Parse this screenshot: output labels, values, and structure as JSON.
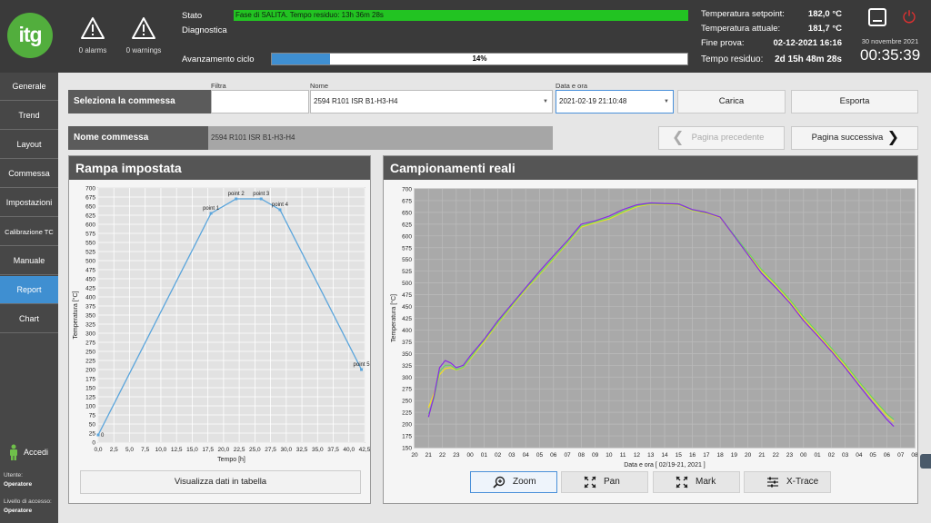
{
  "header": {
    "logo_text": "itg",
    "alarms": "0 alarms",
    "warnings": "0 warnings",
    "stato_label": "Stato",
    "stato_value": "Fase di SALITA. Tempo residuo: 13h 36m 28s",
    "diagnostica_label": "Diagnostica",
    "avanzamento_label": "Avanzamento ciclo",
    "progress_text": "14%",
    "progress_value": 14,
    "info": [
      {
        "label": "Temperatura setpoint:",
        "value": "182,0 °C"
      },
      {
        "label": "Temperatura attuale:",
        "value": "181,7 °C"
      },
      {
        "label": "Fine prova:",
        "value": "02-12-2021 16:16"
      },
      {
        "label": "Tempo residuo:",
        "value": "2d 15h 48m 28s"
      }
    ],
    "date": "30 novembre 2021",
    "time": "00:35:39"
  },
  "sidebar": {
    "items": [
      "Generale",
      "Trend",
      "Layout",
      "Commessa",
      "Impostazioni",
      "Calibrazione TC",
      "Manuale",
      "Report",
      "Chart"
    ],
    "active": "Report",
    "accedi": "Accedi",
    "utente_label": "Utente:",
    "utente_value": "Operatore",
    "livello_label": "Livello di accesso:",
    "livello_value": "Operatore"
  },
  "selection": {
    "title": "Seleziona la commessa",
    "filtra_label": "Filtra",
    "filtra_value": "",
    "nome_label": "Nome",
    "nome_value": "2594 R101 ISR B1-H3-H4",
    "data_label": "Data e ora",
    "data_value": "2021-02-19 21:10:48",
    "carica": "Carica",
    "esporta": "Esporta"
  },
  "nome_commessa": {
    "label": "Nome commessa",
    "value": "2594 R101 ISR B1-H3-H4",
    "prev": "Pagina precedente",
    "next": "Pagina successiva"
  },
  "left_panel": {
    "title": "Rampa impostata",
    "table_button": "Visualizza dati in tabella"
  },
  "right_panel": {
    "title": "Campionamenti reali",
    "tools": [
      "Zoom",
      "Pan",
      "Mark",
      "X-Trace"
    ],
    "selected_tool": "Zoom"
  },
  "colors": {
    "header_bg": "#3a3a3a",
    "sidebar_bg": "#474747",
    "accent": "#3f8fd1",
    "stato_green": "#22c322",
    "ramp_line": "#5aa5dc",
    "series_purple": "#8a2be2",
    "series_yellow": "#f0e020",
    "series_green": "#6ad06a"
  },
  "chart_data": [
    {
      "type": "line",
      "title": "Rampa impostata",
      "xlabel": "Tempo [h]",
      "ylabel": "Temperatura [°C]",
      "xlim": [
        0,
        42.5
      ],
      "ylim": [
        0,
        700
      ],
      "grid": true,
      "x_ticks": [
        "0,0",
        "2,5",
        "5,0",
        "7,5",
        "10,0",
        "12,5",
        "15,0",
        "17,5",
        "20,0",
        "22,5",
        "25,0",
        "27,5",
        "30,0",
        "32,5",
        "35,0",
        "37,5",
        "40,0",
        "42,5"
      ],
      "y_ticks": [
        "0",
        "25",
        "50",
        "75",
        "100",
        "125",
        "150",
        "175",
        "200",
        "225",
        "250",
        "275",
        "300",
        "325",
        "350",
        "375",
        "400",
        "425",
        "450",
        "475",
        "500",
        "525",
        "550",
        "575",
        "600",
        "625",
        "650",
        "675",
        "700"
      ],
      "points": [
        {
          "label": "0",
          "x": 0,
          "y": 20
        },
        {
          "label": "point 1",
          "x": 18,
          "y": 630
        },
        {
          "label": "point 2",
          "x": 22,
          "y": 670
        },
        {
          "label": "point 3",
          "x": 26,
          "y": 670
        },
        {
          "label": "point 4",
          "x": 29,
          "y": 640
        },
        {
          "label": "point 5",
          "x": 42,
          "y": 200
        }
      ]
    },
    {
      "type": "line",
      "title": "Campionamenti reali",
      "xlabel": "Data e ora  [ 02/19-21, 2021 ]",
      "ylabel": "Temperatura [°C]",
      "ylim": [
        150,
        700
      ],
      "grid": true,
      "x_ticks": [
        "20",
        "21",
        "22",
        "23",
        "00",
        "01",
        "02",
        "03",
        "04",
        "05",
        "06",
        "07",
        "08",
        "09",
        "10",
        "11",
        "12",
        "13",
        "14",
        "15",
        "16",
        "17",
        "18",
        "19",
        "20",
        "21",
        "22",
        "23",
        "00",
        "01",
        "02",
        "03",
        "04",
        "05",
        "06",
        "07",
        "08"
      ],
      "y_ticks": [
        "150",
        "175",
        "200",
        "225",
        "250",
        "275",
        "300",
        "325",
        "350",
        "375",
        "400",
        "425",
        "450",
        "475",
        "500",
        "525",
        "550",
        "575",
        "600",
        "625",
        "650",
        "675",
        "700"
      ],
      "x_hours": [
        21,
        21.4,
        21.8,
        22.2,
        22.6,
        23,
        23.5,
        24,
        25,
        26,
        27,
        28,
        29,
        30,
        31,
        32,
        33,
        34,
        35,
        36,
        37,
        38,
        39,
        40,
        41,
        42,
        43,
        44,
        45,
        46,
        47,
        48,
        49,
        50,
        51,
        52,
        53,
        54,
        54.5
      ],
      "series": [
        {
          "color": "#8a2be2",
          "values": [
            215,
            260,
            320,
            335,
            330,
            320,
            325,
            345,
            380,
            420,
            455,
            490,
            525,
            558,
            590,
            625,
            632,
            642,
            656,
            666,
            670,
            669,
            668,
            656,
            650,
            640,
            600,
            560,
            520,
            490,
            458,
            420,
            388,
            355,
            320,
            282,
            245,
            210,
            195
          ]
        },
        {
          "color": "#6ad06a",
          "values": [
            222,
            255,
            312,
            325,
            325,
            316,
            321,
            340,
            378,
            416,
            452,
            488,
            520,
            553,
            586,
            621,
            630,
            638,
            652,
            664,
            669,
            668,
            667,
            655,
            649,
            640,
            602,
            565,
            528,
            498,
            465,
            428,
            395,
            362,
            328,
            290,
            255,
            222,
            210
          ]
        },
        {
          "color": "#f0e020",
          "values": [
            235,
            265,
            305,
            318,
            320,
            315,
            320,
            338,
            375,
            414,
            450,
            486,
            518,
            551,
            584,
            619,
            628,
            636,
            650,
            662,
            668,
            667,
            666,
            654,
            648,
            639,
            600,
            562,
            525,
            495,
            462,
            424,
            392,
            358,
            324,
            288,
            252,
            218,
            205
          ]
        }
      ]
    }
  ]
}
